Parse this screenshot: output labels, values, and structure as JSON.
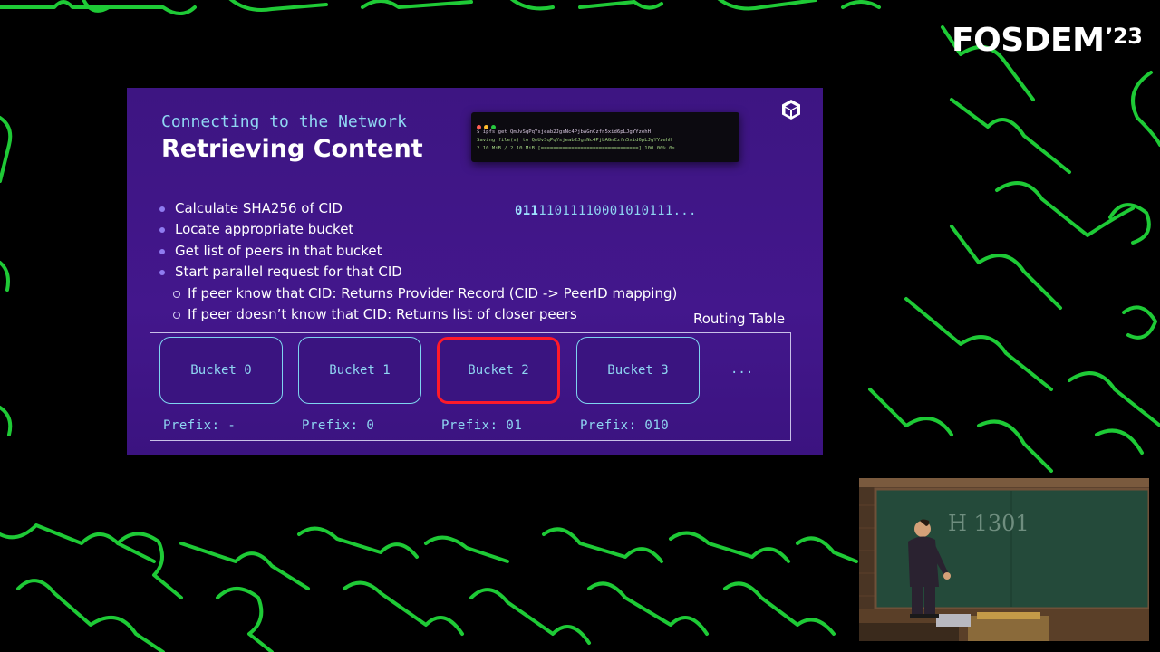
{
  "logo": {
    "text": "FOSDEM",
    "year": "’23"
  },
  "slide": {
    "subtitle": "Connecting to the Network",
    "title": "Retrieving Content",
    "terminal": {
      "line1": "$ ipfs get QmUvSqPqYsjeab2JgsNc4PjbAGnCzfn5xid6pLJgYYzehH",
      "line2": "Saving file(s) to QmUvSqPqYsjeab2JgsNc4PjbAGnCzfn5xid6pLJgYYzehH",
      "line3": " 2.10 MiB / 2.10 MiB [================================] 100.00% 0s"
    },
    "bullets": [
      "Calculate SHA256 of CID",
      "Locate appropriate bucket",
      "Get list of peers in that bucket",
      "Start parallel request for that CID"
    ],
    "sub_bullets": [
      "If peer know that CID: Returns Provider Record (CID -> PeerID mapping)",
      "If peer doesn’t know that CID: Returns list of closer peers"
    ],
    "bits": {
      "highlight": "011",
      "rest": "11011110001010111..."
    },
    "routing_table": {
      "label": "Routing Table",
      "buckets": [
        {
          "label": "Bucket 0",
          "prefix": "Prefix: -"
        },
        {
          "label": "Bucket 1",
          "prefix": "Prefix: 0"
        },
        {
          "label": "Bucket 2",
          "prefix": "Prefix: 01",
          "selected": true
        },
        {
          "label": "Bucket 3",
          "prefix": "Prefix: 010"
        }
      ],
      "ellipsis": "..."
    }
  },
  "camera": {
    "board_text": "H 1301"
  },
  "colors": {
    "puzzle": "#22e03c",
    "slide_bg": "#3d1582",
    "highlight": "#ff1a2a",
    "accent": "#8fd6f2"
  }
}
